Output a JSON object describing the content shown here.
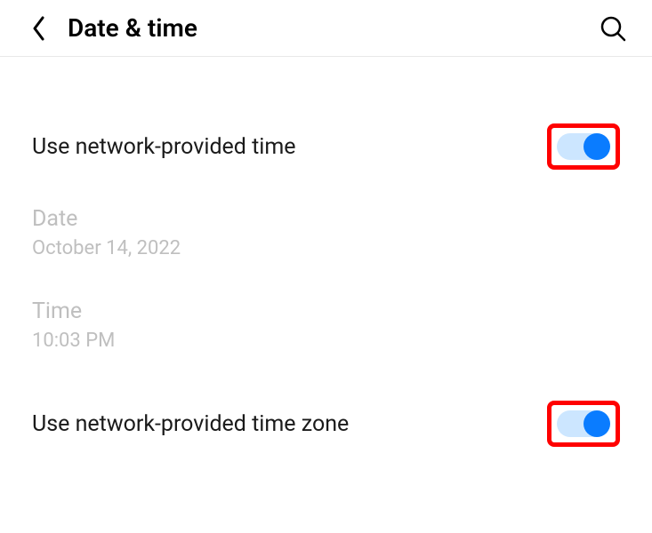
{
  "header": {
    "title": "Date & time"
  },
  "rows": {
    "network_time": {
      "label": "Use network-provided time",
      "on": true
    },
    "date": {
      "label": "Date",
      "value": "October 14, 2022"
    },
    "time": {
      "label": "Time",
      "value": "10:03 PM"
    },
    "network_tz": {
      "label": "Use network-provided time zone",
      "on": true
    }
  },
  "colors": {
    "toggle_on_knob": "#0a7cff",
    "toggle_on_track": "#cce6ff",
    "highlight": "#ff0000"
  }
}
